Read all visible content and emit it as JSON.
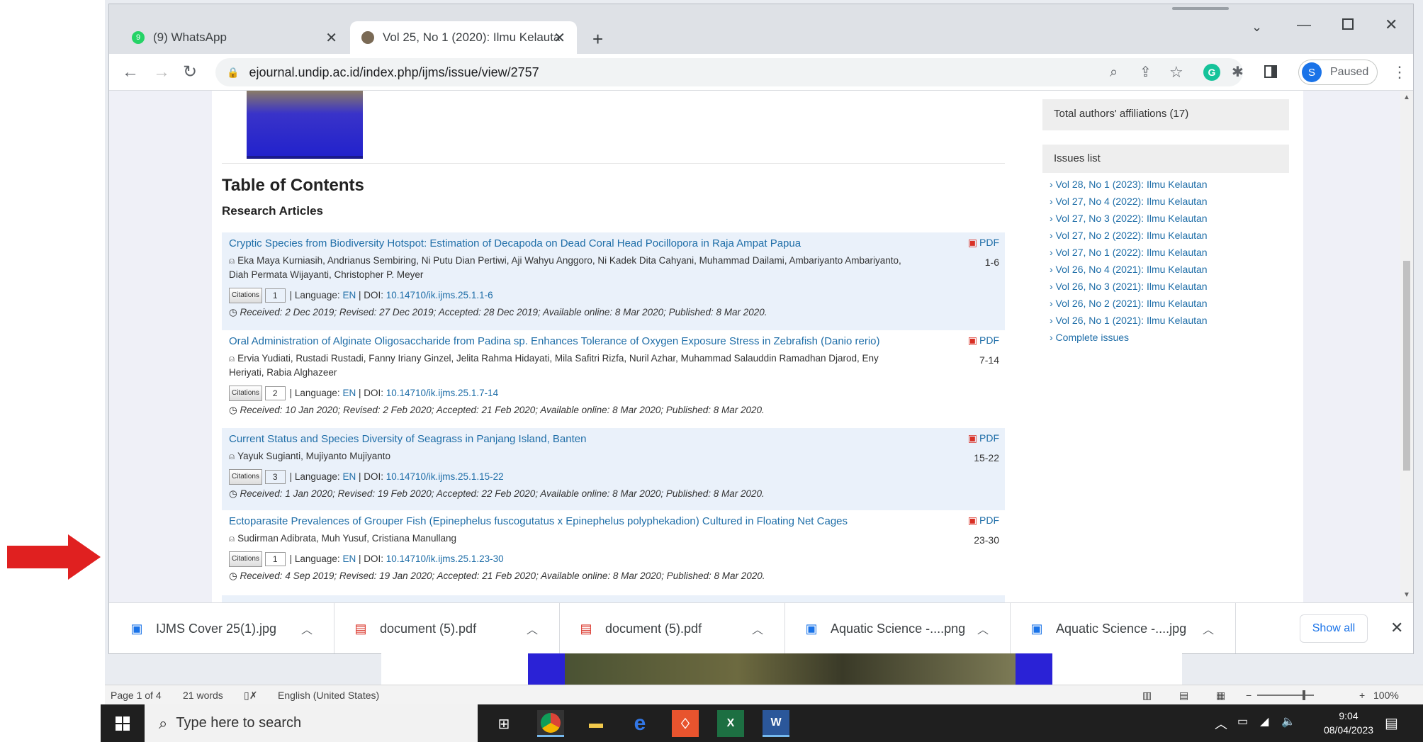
{
  "browser": {
    "tabs": [
      {
        "label": "(9) WhatsApp",
        "favicon_color": "#25d366",
        "badge": "9"
      },
      {
        "label": "Vol 25, No 1 (2020): Ilmu Kelauta",
        "favicon_color": "#7a6a55"
      }
    ],
    "url": "ejournal.undip.ac.id/index.php/ijms/issue/view/2757",
    "profile_initial": "S",
    "profile_status": "Paused"
  },
  "page": {
    "toc_title": "Table of Contents",
    "section_title": "Research Articles",
    "citations_label": "Citations",
    "language_label": "| Language:",
    "doi_label": "| DOI:",
    "pdf_label": "PDF",
    "articles": [
      {
        "title": "Cryptic Species from Biodiversity Hotspot: Estimation of Decapoda on Dead Coral Head Pocillopora in Raja Ampat Papua",
        "authors": "Eka Maya Kurniasih, Andrianus Sembiring, Ni Putu Dian Pertiwi, Aji Wahyu Anggoro, Ni Kadek Dita Cahyani, Muhammad Dailami, Ambariyanto Ambariyanto, Diah Permata Wijayanti, Christopher P. Meyer",
        "citations": "1",
        "language": "EN",
        "doi": "10.14710/ik.ijms.25.1.1-6",
        "dates": "Received: 2 Dec 2019; Revised: 27 Dec 2019; Accepted: 28 Dec 2019; Available online: 8 Mar 2020; Published: 8 Mar 2020.",
        "pages": "1-6"
      },
      {
        "title": "Oral Administration of Alginate Oligosaccharide from Padina sp. Enhances Tolerance of Oxygen Exposure Stress in Zebrafish (Danio rerio)",
        "authors": "Ervia Yudiati, Rustadi Rustadi, Fanny Iriany Ginzel, Jelita Rahma Hidayati, Mila Safitri Rizfa, Nuril Azhar, Muhammad Salauddin Ramadhan Djarod, Eny Heriyati, Rabia Alghazeer",
        "citations": "2",
        "language": "EN",
        "doi": "10.14710/ik.ijms.25.1.7-14",
        "dates": "Received: 10 Jan 2020; Revised: 2 Feb 2020; Accepted: 21 Feb 2020; Available online: 8 Mar 2020; Published: 8 Mar 2020.",
        "pages": "7-14"
      },
      {
        "title": "Current Status and Species Diversity of Seagrass in Panjang Island, Banten",
        "authors": "Yayuk Sugianti, Mujiyanto Mujiyanto",
        "citations": "3",
        "language": "EN",
        "doi": "10.14710/ik.ijms.25.1.15-22",
        "dates": "Received: 1 Jan 2020; Revised: 19 Feb 2020; Accepted: 22 Feb 2020; Available online: 8 Mar 2020; Published: 8 Mar 2020.",
        "pages": "15-22"
      },
      {
        "title": "Ectoparasite Prevalences of Grouper Fish (Epinephelus fuscogutatus x Epinephelus polyphekadion) Cultured in Floating Net Cages",
        "authors": "Sudirman Adibrata, Muh Yusuf, Cristiana Manullang",
        "citations": "1",
        "language": "EN",
        "doi": "10.14710/ik.ijms.25.1.23-30",
        "dates": "Received: 4 Sep 2019; Revised: 19 Jan 2020; Accepted: 21 Feb 2020; Available online: 8 Mar 2020; Published: 8 Mar 2020.",
        "pages": "23-30"
      }
    ],
    "sidebar": {
      "affiliations": "Total authors' affiliations (17)",
      "issues_heading": "Issues list",
      "issues": [
        "› Vol 28, No 1 (2023): Ilmu Kelautan",
        "› Vol 27, No 4 (2022): Ilmu Kelautan",
        "› Vol 27, No 3 (2022): Ilmu Kelautan",
        "› Vol 27, No 2 (2022): Ilmu Kelautan",
        "› Vol 27, No 1 (2022): Ilmu Kelautan",
        "› Vol 26, No 4 (2021): Ilmu Kelautan",
        "› Vol 26, No 3 (2021): Ilmu Kelautan",
        "› Vol 26, No 2 (2021): Ilmu Kelautan",
        "› Vol 26, No 1 (2021): Ilmu Kelautan",
        "› Complete issues"
      ]
    }
  },
  "downloads": {
    "items": [
      {
        "name": "IJMS Cover 25(1).jpg",
        "icon": "image-file-icon"
      },
      {
        "name": "document (5).pdf",
        "icon": "pdf-file-icon"
      },
      {
        "name": "document (5).pdf",
        "icon": "pdf-file-icon"
      },
      {
        "name": "Aquatic Science -....png",
        "icon": "image-file-icon"
      },
      {
        "name": "Aquatic Science -....jpg",
        "icon": "image-file-icon"
      }
    ],
    "show_all": "Show all"
  },
  "word_status": {
    "page": "Page 1 of 4",
    "words": "21 words",
    "language": "English (United States)",
    "zoom": "100%"
  },
  "taskbar": {
    "search_placeholder": "Type here to search",
    "time": "9:04",
    "date": "08/04/2023"
  },
  "colors": {
    "link": "#1f6ea8",
    "arrow": "#e02020",
    "accent": "#1a73e8"
  }
}
